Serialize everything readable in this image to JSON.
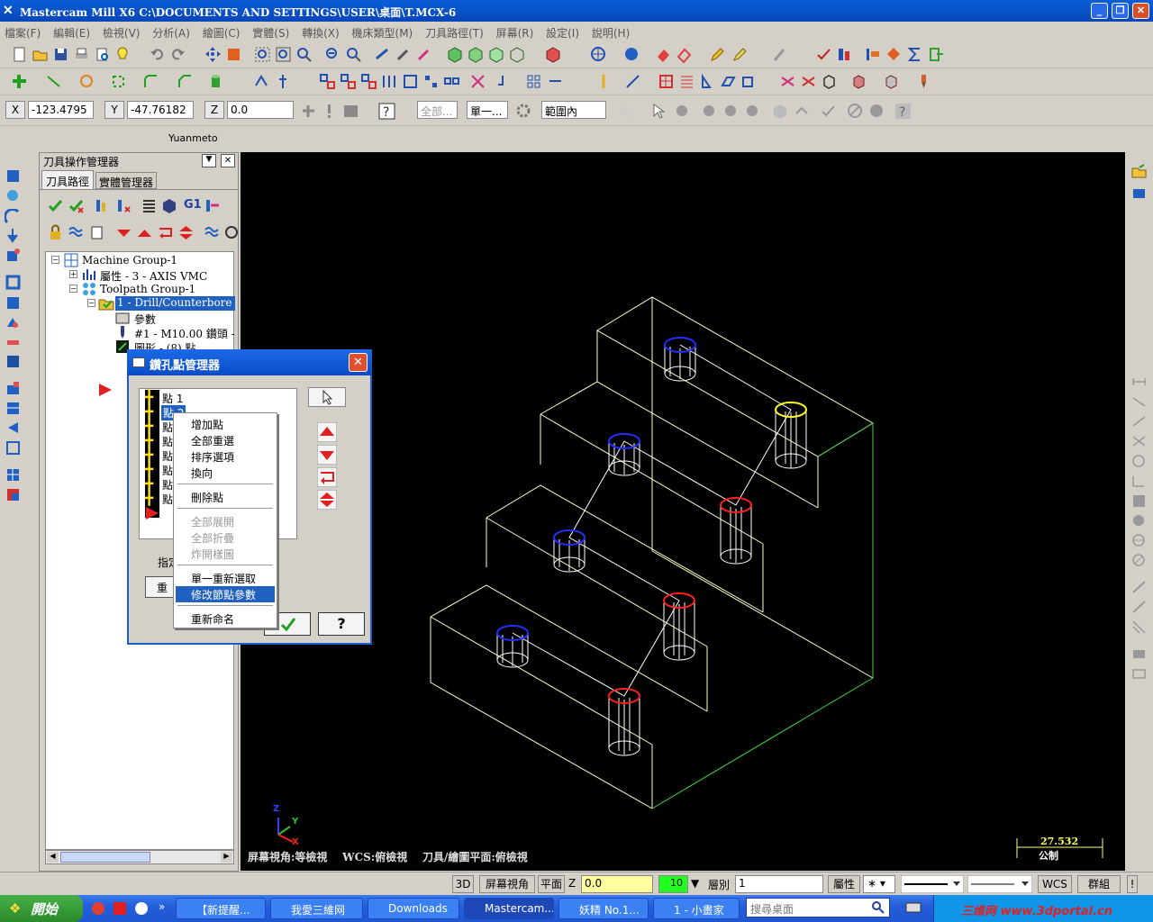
{
  "window": {
    "title": "Mastercam Mill X6  C:\\DOCUMENTS AND SETTINGS\\USER\\桌面\\T.MCX-6"
  },
  "menu": [
    "檔案(F)",
    "編輯(E)",
    "檢視(V)",
    "分析(A)",
    "繪圖(C)",
    "實體(S)",
    "轉換(X)",
    "機床類型(M)",
    "刀具路徑(T)",
    "屏幕(R)",
    "設定(I)",
    "說明(H)"
  ],
  "coords": {
    "x_label": "X",
    "x": "-123.4795",
    "y_label": "Y",
    "y": "-47.76182",
    "z_label": "Z",
    "z": "0.0",
    "all_label": "全部...",
    "single_label": "單一...",
    "range_label": "範圍內"
  },
  "toolbar_caption": "Yuanmeto",
  "panel": {
    "title": "刀具操作管理器",
    "tab_toolpath": "刀具路徑",
    "tab_solids": "實體管理器"
  },
  "tree": [
    "Machine Group-1",
    "屬性 - 3 - AXIS VMC",
    "Toolpath Group-1",
    "1 - Drill/Counterbore - [WC",
    "參數",
    "#1 - M10.00 鑽頭 -",
    "圖形 - (8) 點"
  ],
  "dialog": {
    "title": "鑽孔點管理器",
    "points": [
      "點 1",
      "點 2",
      "點",
      "點",
      "點",
      "點",
      "點",
      "點"
    ],
    "designate_label": "指定",
    "reset_label": "重設"
  },
  "context_menu": {
    "add": "增加點",
    "reselect_all": "全部重選",
    "sort": "排序選項",
    "reverse": "換向",
    "delete": "刪除點",
    "expand_all": "全部展開",
    "collapse_all": "全部折疊",
    "explode": "炸開樣圖",
    "single_reselect": "單一重新選取",
    "modify_params": "修改節點參數",
    "rename": "重新命名"
  },
  "viewport": {
    "status": "屏幕視角:等檢視    WCS:俯檢視    刀具/繪圖平面:俯檢視",
    "scale_value": "27.532",
    "scale_unit": "公制",
    "axis_z": "Z",
    "axis_y": "Y",
    "axis_x": "X"
  },
  "statusbar": {
    "d3": "3D",
    "screen_view": "屏幕視角",
    "plane": "平面",
    "z_label": "Z",
    "z_value": "0.0",
    "color": "10",
    "level_label": "層別",
    "level": "1",
    "attr": "屬性",
    "wcs": "WCS",
    "group": "群組"
  },
  "taskbar": {
    "start": "開始",
    "tasks": [
      "【新提醒...",
      "我愛三維网",
      "Downloads",
      "Mastercam...",
      "妖精 No.1...",
      "1 - 小畫家"
    ],
    "search": "搜尋桌面",
    "watermark": "三维网 www.3dportal.cn"
  }
}
